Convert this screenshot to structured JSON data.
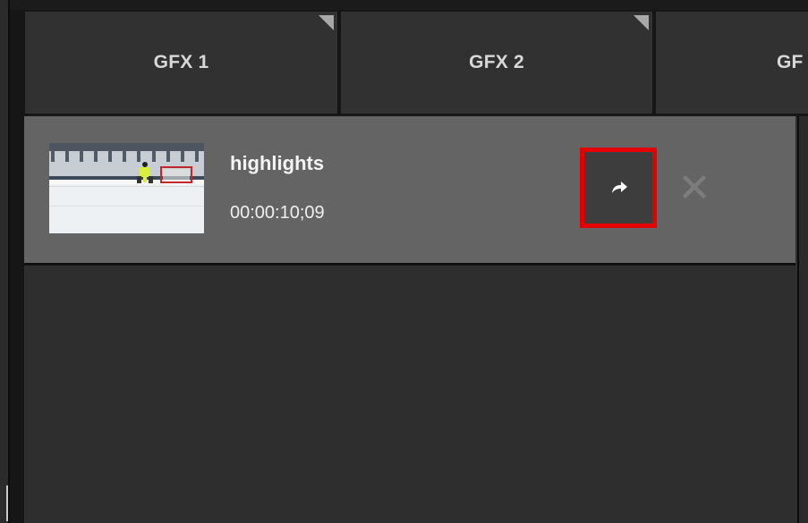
{
  "tabs": [
    {
      "label": "GFX 1"
    },
    {
      "label": "GFX 2"
    },
    {
      "label": "GF"
    }
  ],
  "clip": {
    "title": "highlights",
    "duration": "00:00:10;09",
    "thumbnail": "hockey-goalie-thumbnail"
  },
  "actions": {
    "send": "share-arrow-icon",
    "remove": "close-icon"
  },
  "colors": {
    "background": "#161616",
    "tab": "#313131",
    "row": "#646464",
    "highlight": "#e40000"
  }
}
